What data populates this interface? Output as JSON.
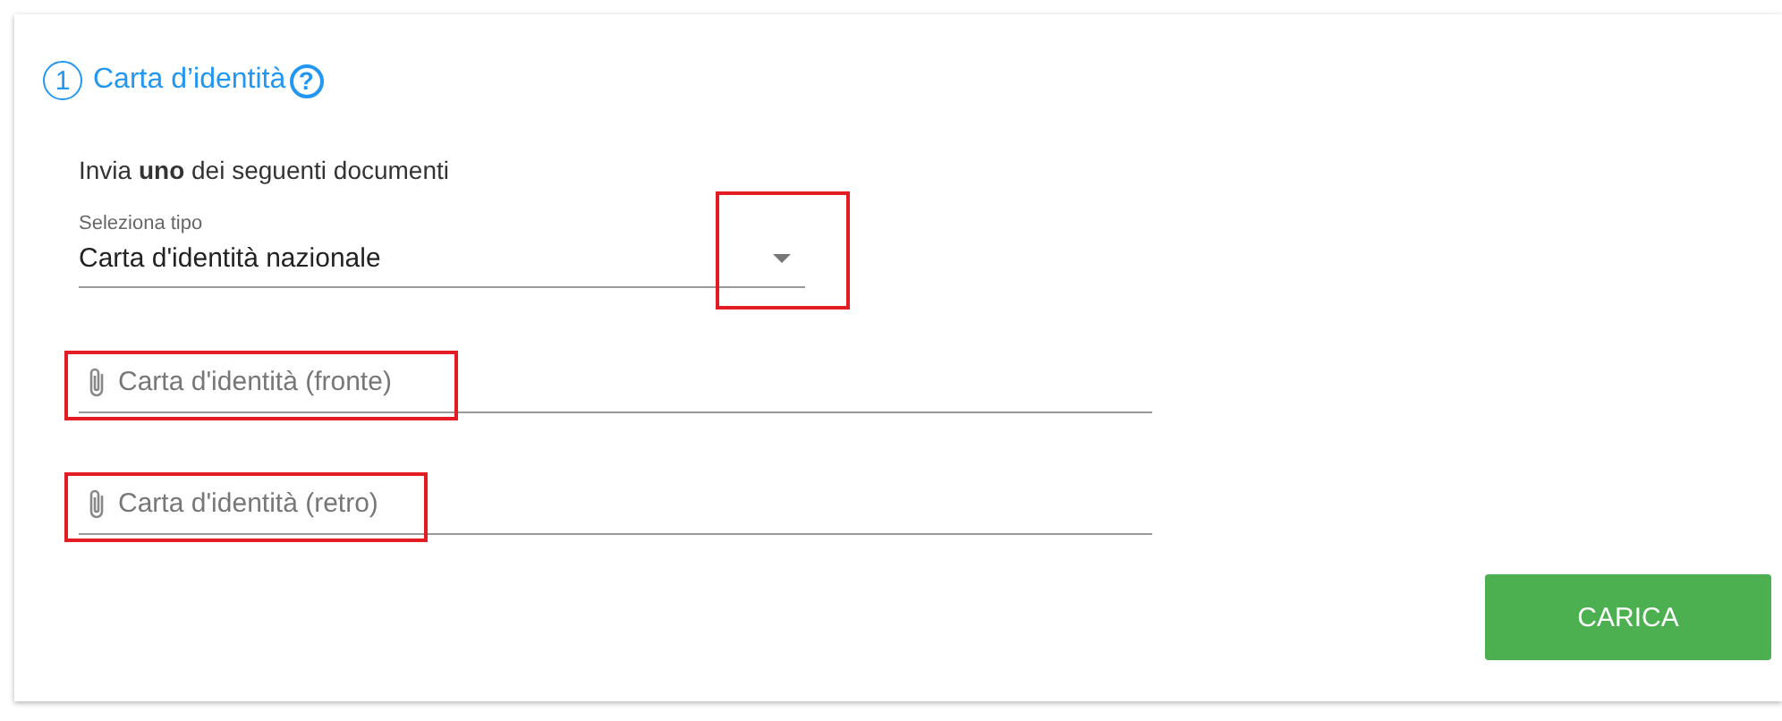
{
  "section": {
    "step": "1",
    "title": "Carta d’identità",
    "help": "?"
  },
  "instruction": "Invia **uno** dei seguenti documenti",
  "select": {
    "label": "Seleziona tipo",
    "value": "Carta d'identità nazionale",
    "highlighted": true
  },
  "file_fields": [
    {
      "placeholder": "Carta d'identità (fronte)",
      "highlighted": true
    },
    {
      "placeholder": "Carta d'identità (retro)",
      "highlighted": true
    }
  ],
  "buttons": [
    {
      "label": "CARICA"
    }
  ]
}
